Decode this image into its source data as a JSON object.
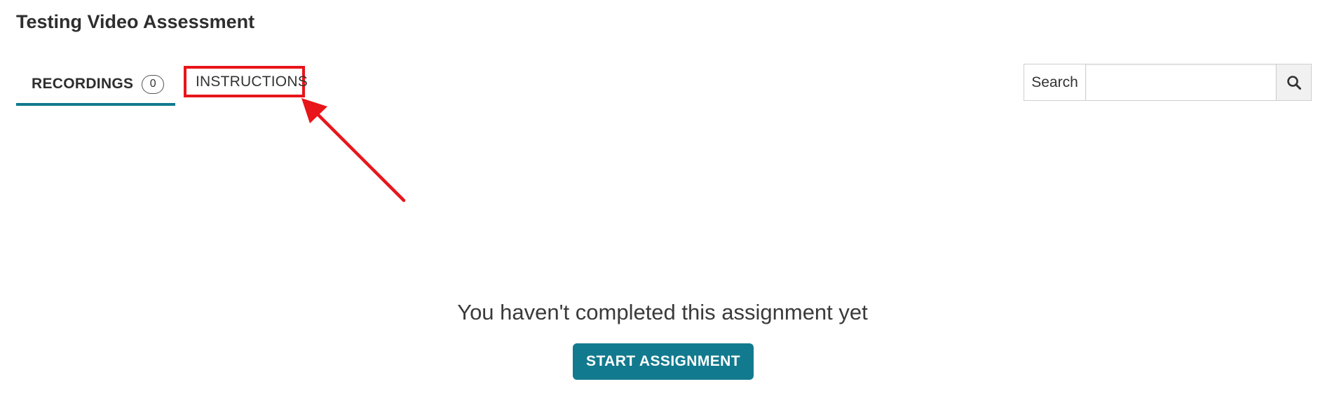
{
  "page": {
    "title": "Testing Video Assessment"
  },
  "tabs": [
    {
      "label": "RECORDINGS",
      "count": "0",
      "active": true
    },
    {
      "label": "INSTRUCTIONS",
      "active": false,
      "highlighted": true
    }
  ],
  "search": {
    "label": "Search",
    "value": "",
    "placeholder": "",
    "button_icon": "search-icon"
  },
  "empty_state": {
    "message": "You haven't completed this assignment yet",
    "button_label": "START ASSIGNMENT"
  },
  "colors": {
    "accent": "#127a8e",
    "highlight_box": "#e8151b",
    "annotation_arrow": "#e8151b"
  },
  "annotation": {
    "icon": "arrow-icon",
    "target": "INSTRUCTIONS"
  }
}
